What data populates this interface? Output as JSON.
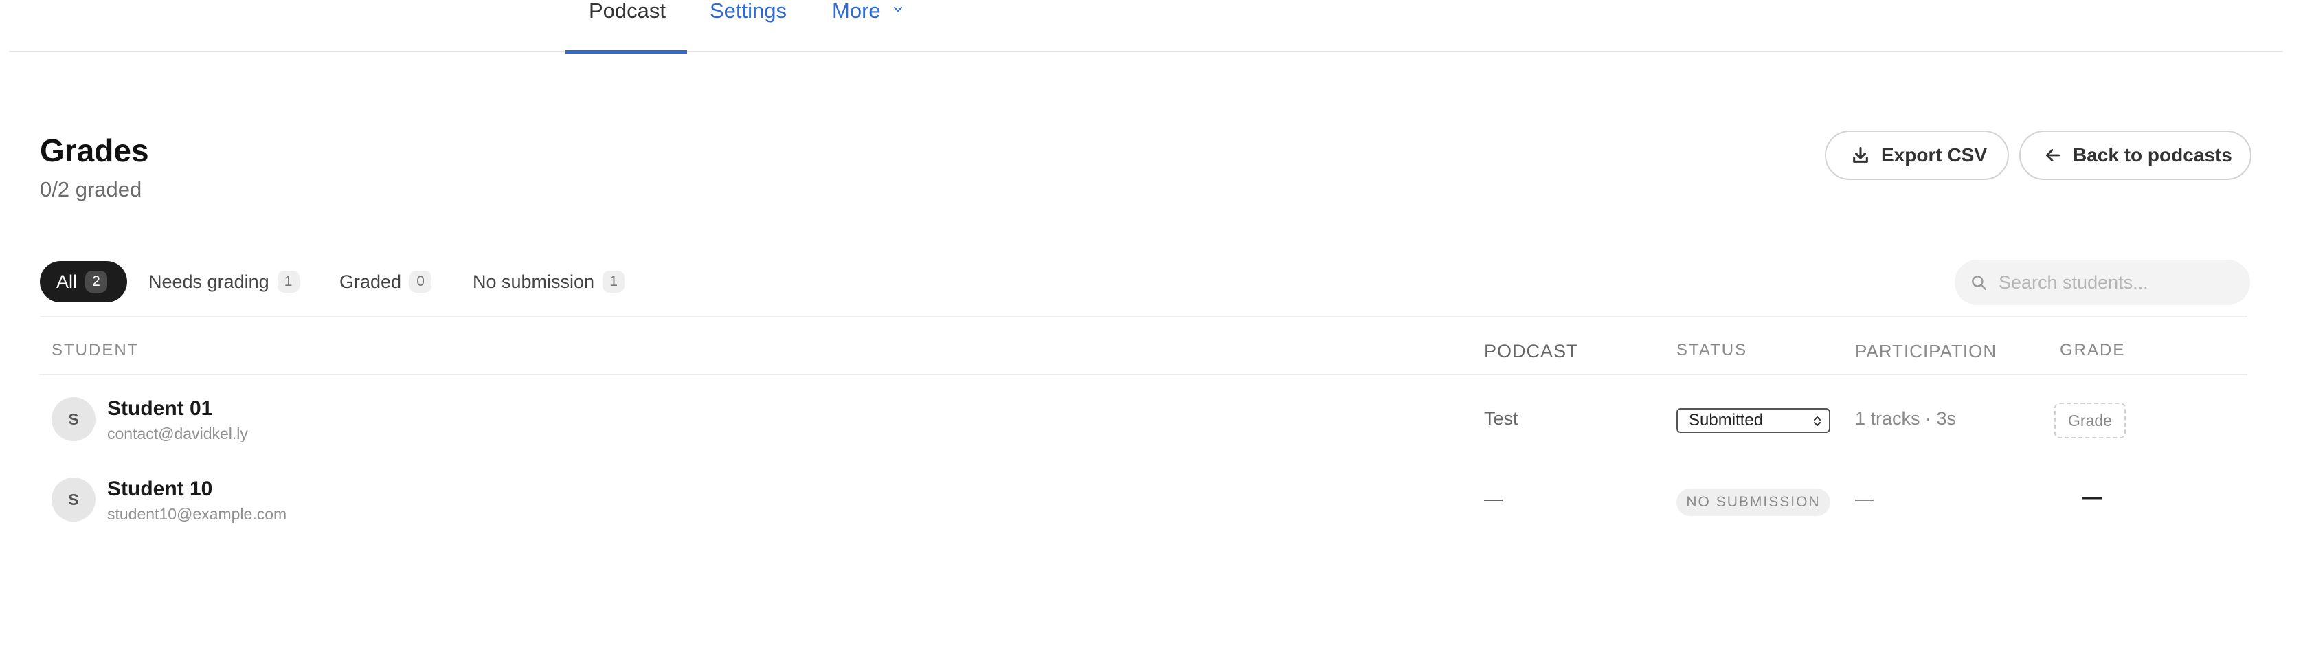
{
  "nav": {
    "tabs": [
      {
        "label": "Podcast"
      },
      {
        "label": "Settings"
      },
      {
        "label": "More"
      }
    ]
  },
  "header": {
    "title": "Grades",
    "subtitle": "0/2 graded",
    "export_label": "Export CSV",
    "back_label": "Back to podcasts"
  },
  "filters": [
    {
      "label": "All",
      "count": "2",
      "selected": true
    },
    {
      "label": "Needs grading",
      "count": "1"
    },
    {
      "label": "Graded",
      "count": "0"
    },
    {
      "label": "No submission",
      "count": "1"
    }
  ],
  "search": {
    "placeholder": "Search students..."
  },
  "table": {
    "columns": [
      "Student",
      "Podcast",
      "Status",
      "Participation",
      "Grade"
    ],
    "rows": [
      {
        "initial": "S",
        "name": "Student 01",
        "email": "contact@davidkel.ly",
        "podcast": "Test",
        "status": "Submitted",
        "participation": "1 tracks · 3s",
        "grade": "Grade"
      },
      {
        "initial": "S",
        "name": "Student 10",
        "email": "student10@example.com",
        "podcast": "—",
        "status": "NO SUBMISSION",
        "participation": "—",
        "grade": "—"
      }
    ]
  },
  "colors": {
    "accent": "#2f6ad0",
    "pill_active": "#1c1c1c"
  }
}
